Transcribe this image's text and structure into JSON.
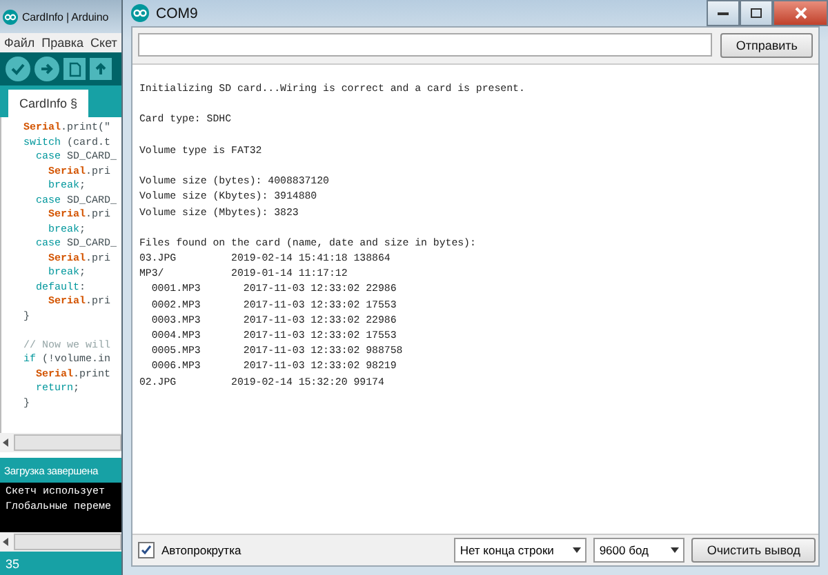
{
  "ide": {
    "title": "CardInfo | Arduino",
    "menu": [
      "Файл",
      "Правка",
      "Скет"
    ],
    "tabs": [
      {
        "label": "CardInfo §",
        "selected": true
      }
    ],
    "code": [
      [
        [
          {
            "text": "Serial",
            "kind": "class"
          },
          {
            "text": ".print(\"",
            "kind": "plain"
          }
        ],
        [
          {
            "text": "switch",
            "kind": "keyword"
          },
          {
            "text": " (card.t",
            "kind": "plain"
          }
        ],
        [
          {
            "text": "  case",
            "kind": "keyword"
          },
          {
            "text": " SD_CARD_",
            "kind": "plain"
          }
        ],
        [
          {
            "text": "    Serial",
            "kind": "class"
          },
          {
            "text": ".pri",
            "kind": "plain"
          }
        ],
        [
          {
            "text": "    break",
            "kind": "keyword"
          },
          {
            "text": ";",
            "kind": "plain"
          }
        ],
        [
          {
            "text": "  case",
            "kind": "keyword"
          },
          {
            "text": " SD_CARD_",
            "kind": "plain"
          }
        ],
        [
          {
            "text": "    Serial",
            "kind": "class"
          },
          {
            "text": ".pri",
            "kind": "plain"
          }
        ],
        [
          {
            "text": "    break",
            "kind": "keyword"
          },
          {
            "text": ";",
            "kind": "plain"
          }
        ],
        [
          {
            "text": "  case",
            "kind": "keyword"
          },
          {
            "text": " SD_CARD_",
            "kind": "plain"
          }
        ],
        [
          {
            "text": "    Serial",
            "kind": "class"
          },
          {
            "text": ".pri",
            "kind": "plain"
          }
        ],
        [
          {
            "text": "    break",
            "kind": "keyword"
          },
          {
            "text": ";",
            "kind": "plain"
          }
        ],
        [
          {
            "text": "  default",
            "kind": "keyword"
          },
          {
            "text": ":",
            "kind": "plain"
          }
        ],
        [
          {
            "text": "    Serial",
            "kind": "class"
          },
          {
            "text": ".pri",
            "kind": "plain"
          }
        ],
        [
          {
            "text": "}",
            "kind": "plain"
          }
        ]
      ],
      [
        [
          {
            "text": "// Now we will",
            "kind": "comment"
          }
        ],
        [
          {
            "text": "if",
            "kind": "keyword"
          },
          {
            "text": " (!volume.in",
            "kind": "plain"
          }
        ],
        [
          {
            "text": "  Serial",
            "kind": "class"
          },
          {
            "text": ".print",
            "kind": "plain"
          }
        ],
        [
          {
            "text": "  return",
            "kind": "keyword"
          },
          {
            "text": ";",
            "kind": "plain"
          }
        ],
        [
          {
            "text": "}",
            "kind": "plain"
          }
        ]
      ]
    ],
    "status": "Загрузка завершена",
    "console": [
      "Скетч использует",
      "Глобальные переме"
    ],
    "line_number": "35"
  },
  "monitor": {
    "title": "COM9",
    "send_button": "Отправить",
    "output": [
      [
        "Initializing SD card...Wiring is correct and a card is present."
      ],
      [
        "Card type: SDHC"
      ],
      [
        "Volume type is FAT32"
      ],
      [
        "Volume size (bytes): 4008837120",
        "Volume size (Kbytes): 3914880",
        "Volume size (Mbytes): 3823"
      ],
      [
        "Files found on the card (name, date and size in bytes):",
        "03.JPG         2019-02-14 15:41:18 138864",
        "MP3/           2019-01-14 11:17:12",
        "  0001.MP3       2017-11-03 12:33:02 22986",
        "  0002.MP3       2017-11-03 12:33:02 17553",
        "  0003.MP3       2017-11-03 12:33:02 22986",
        "  0004.MP3       2017-11-03 12:33:02 17553",
        "  0005.MP3       2017-11-03 12:33:02 988758",
        "  0006.MP3       2017-11-03 12:33:02 98219",
        "02.JPG         2019-02-14 15:32:20 99174"
      ]
    ],
    "autoscroll": {
      "label": "Автопрокрутка",
      "checked": true
    },
    "line_ending": "Нет конца строки",
    "baud": "9600 бод",
    "clear_button": "Очистить вывод"
  }
}
